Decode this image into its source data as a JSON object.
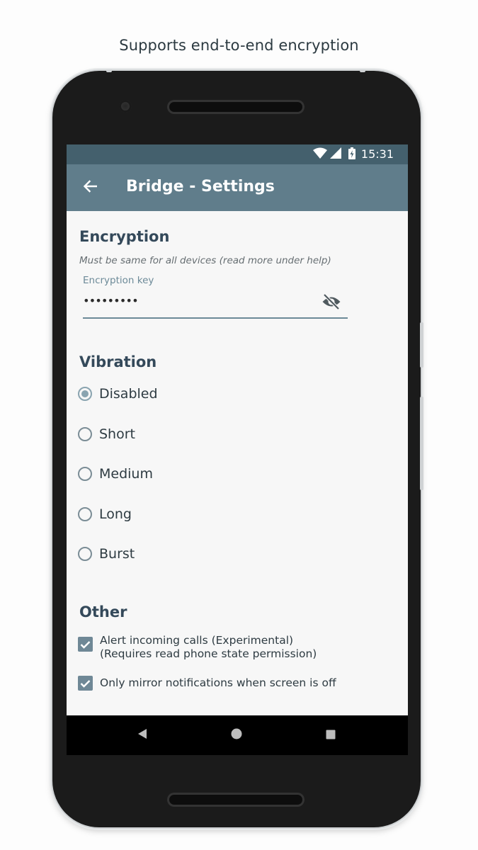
{
  "caption": "Supports end-to-end encryption",
  "status_bar": {
    "time": "15:31",
    "icons": [
      "wifi-icon",
      "cell-signal-icon",
      "battery-charging-icon"
    ]
  },
  "app_bar": {
    "title": "Bridge - Settings",
    "back_icon": "arrow-back-icon"
  },
  "encryption": {
    "title": "Encryption",
    "hint": "Must be same for all devices (read more under help)",
    "field_label": "Encryption key",
    "field_value": "•••••••••",
    "toggle_icon": "visibility-off-icon"
  },
  "vibration": {
    "title": "Vibration",
    "options": [
      {
        "label": "Disabled",
        "checked": true
      },
      {
        "label": "Short",
        "checked": false
      },
      {
        "label": "Medium",
        "checked": false
      },
      {
        "label": "Long",
        "checked": false
      },
      {
        "label": "Burst",
        "checked": false
      }
    ]
  },
  "other": {
    "title": "Other",
    "options": [
      {
        "line1": "Alert incoming calls (Experimental)",
        "line2": "(Requires read phone state permission)",
        "checked": true
      },
      {
        "line1": "Only mirror notifications when screen is off",
        "line2": "",
        "checked": true
      }
    ]
  },
  "nav_bar": {
    "icons": [
      "nav-back-icon",
      "nav-home-icon",
      "nav-recents-icon"
    ]
  },
  "colors": {
    "status_bar": "#44606d",
    "app_bar": "#607d8b",
    "accent": "#8aa4b0",
    "checkbox": "#6f8896",
    "section_title": "#34495a"
  }
}
